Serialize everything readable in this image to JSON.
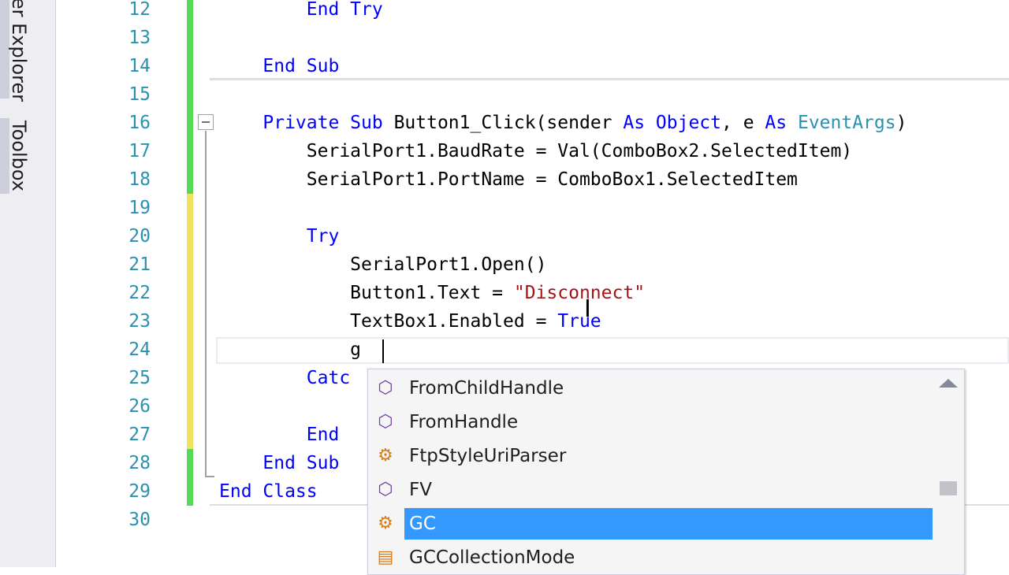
{
  "side_tabs": [
    {
      "label": "er Explorer"
    },
    {
      "label": "Toolbox"
    }
  ],
  "editor": {
    "lines": [
      {
        "num": "12",
        "tokens": [
          {
            "t": "        ",
            "c": ""
          },
          {
            "t": "End Try",
            "c": "kw"
          }
        ]
      },
      {
        "num": "13",
        "tokens": []
      },
      {
        "num": "14",
        "tokens": [
          {
            "t": "    ",
            "c": ""
          },
          {
            "t": "End Sub",
            "c": "kw"
          }
        ]
      },
      {
        "num": "15",
        "tokens": []
      },
      {
        "num": "16",
        "tokens": [
          {
            "t": "    ",
            "c": ""
          },
          {
            "t": "Private Sub",
            "c": "kw"
          },
          {
            "t": " Button1_Click(sender ",
            "c": ""
          },
          {
            "t": "As",
            "c": "kw"
          },
          {
            "t": " ",
            "c": ""
          },
          {
            "t": "Object",
            "c": "kw"
          },
          {
            "t": ", e ",
            "c": ""
          },
          {
            "t": "As",
            "c": "kw"
          },
          {
            "t": " ",
            "c": ""
          },
          {
            "t": "EventArgs",
            "c": "ty"
          },
          {
            "t": ")",
            "c": ""
          }
        ]
      },
      {
        "num": "17",
        "tokens": [
          {
            "t": "        SerialPort1.BaudRate = Val(ComboBox2.SelectedItem)",
            "c": ""
          }
        ]
      },
      {
        "num": "18",
        "tokens": [
          {
            "t": "        SerialPort1.PortName = ComboBox1.SelectedItem",
            "c": ""
          }
        ]
      },
      {
        "num": "19",
        "tokens": []
      },
      {
        "num": "20",
        "tokens": [
          {
            "t": "        ",
            "c": ""
          },
          {
            "t": "Try",
            "c": "kw"
          }
        ]
      },
      {
        "num": "21",
        "tokens": [
          {
            "t": "            SerialPort1.Open()",
            "c": ""
          }
        ]
      },
      {
        "num": "22",
        "tokens": [
          {
            "t": "            Button1.Text = ",
            "c": ""
          },
          {
            "t": "\"Disconnect\"",
            "c": "str"
          }
        ]
      },
      {
        "num": "23",
        "tokens": [
          {
            "t": "            TextBox1.Enabled = ",
            "c": ""
          },
          {
            "t": "True",
            "c": "kw"
          }
        ]
      },
      {
        "num": "24",
        "tokens": [
          {
            "t": "            g",
            "c": ""
          }
        ]
      },
      {
        "num": "25",
        "tokens": [
          {
            "t": "        ",
            "c": ""
          },
          {
            "t": "Catc",
            "c": "kw"
          }
        ]
      },
      {
        "num": "26",
        "tokens": []
      },
      {
        "num": "27",
        "tokens": [
          {
            "t": "        ",
            "c": ""
          },
          {
            "t": "End",
            "c": "kw"
          }
        ]
      },
      {
        "num": "28",
        "tokens": [
          {
            "t": "    ",
            "c": ""
          },
          {
            "t": "End Sub",
            "c": "kw"
          }
        ]
      },
      {
        "num": "29",
        "tokens": [
          {
            "t": "End Class",
            "c": "kw"
          }
        ]
      },
      {
        "num": "30",
        "tokens": []
      }
    ]
  },
  "intellisense": {
    "items": [
      {
        "label": "FromChildHandle",
        "icon": "method-icon",
        "glyph": "⬡",
        "kind": "m"
      },
      {
        "label": "FromHandle",
        "icon": "method-icon",
        "glyph": "⬡",
        "kind": "m"
      },
      {
        "label": "FtpStyleUriParser",
        "icon": "class-icon",
        "glyph": "⚙",
        "kind": "c"
      },
      {
        "label": "FV",
        "icon": "method-icon",
        "glyph": "⬡",
        "kind": "m"
      },
      {
        "label": "GC",
        "icon": "class-icon",
        "glyph": "⚙",
        "kind": "c",
        "selected": true
      },
      {
        "label": "GCCollectionMode",
        "icon": "enum-icon",
        "glyph": "▤",
        "kind": "c"
      }
    ]
  },
  "colors": {
    "saved_change": "#57d857",
    "unsaved_change": "#f2e35e",
    "selection": "#3399ff"
  }
}
